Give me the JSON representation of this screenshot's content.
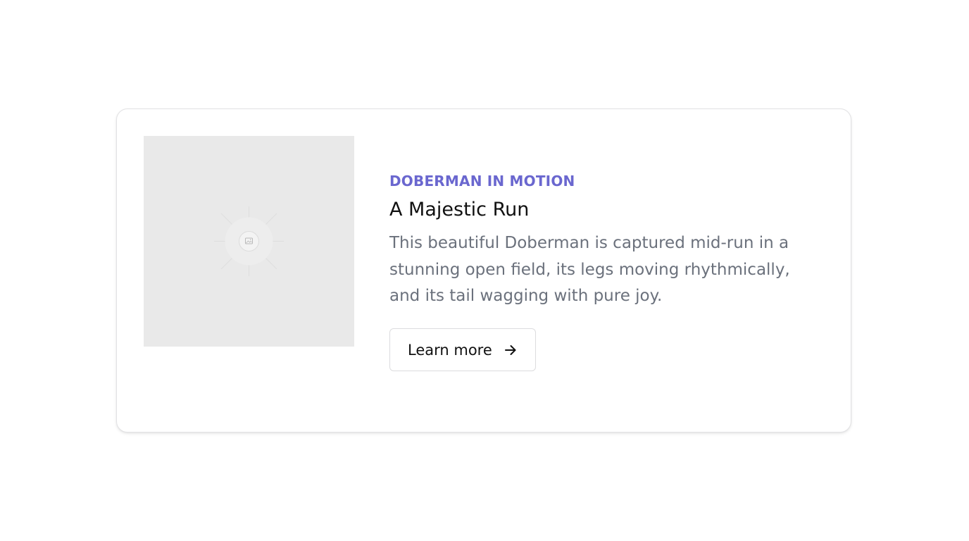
{
  "card": {
    "image": {
      "icon": "image-icon",
      "background_color": "#e9e9e9"
    },
    "eyebrow": "DOBERMAN IN MOTION",
    "title": "A Majestic Run",
    "description": "This beautiful Doberman is captured mid-run in a stunning open field, its legs moving rhythmically, and its tail wagging with pure joy.",
    "button": {
      "label": "Learn more",
      "icon": "arrow-right-icon"
    }
  },
  "colors": {
    "accent": "#6a67cf",
    "title": "#111111",
    "body_text": "#6b717c",
    "border": "#e2e2e4"
  }
}
